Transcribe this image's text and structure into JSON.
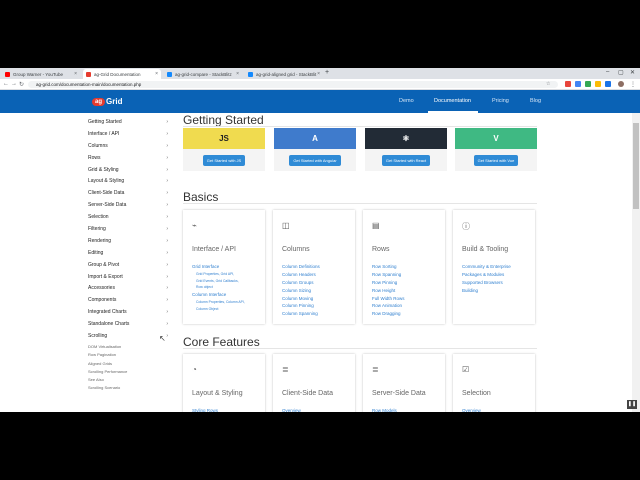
{
  "tabs": [
    {
      "title": "Group Warner - YouTube",
      "color": "#ff0000"
    },
    {
      "title": "ag-Grid Documentation",
      "color": "#e63b2e"
    },
    {
      "title": "ag-grid-compare - StackBlitz",
      "color": "#1389fd"
    },
    {
      "title": "ag-grid-aligned grid - StackBlit",
      "color": "#1389fd"
    }
  ],
  "address": "ag-grid.com/documentation-main/documentation.php",
  "site": {
    "logo_badge": "ag",
    "logo_word": "Grid",
    "nav": [
      "Demo",
      "Documentation",
      "Pricing",
      "Blog"
    ]
  },
  "sidebar": {
    "items": [
      "Getting Started",
      "Interface / API",
      "Columns",
      "Rows",
      "Grid & Styling",
      "Layout & Styling",
      "Client-Side Data",
      "Server-Side Data",
      "Selection",
      "Filtering",
      "Rendering",
      "Editing",
      "Group & Pivot",
      "Import & Export",
      "Accessories",
      "Components",
      "Integrated Charts",
      "Standalone Charts",
      "Scrolling"
    ],
    "sub": [
      "DOM Virtualisation",
      "Row Pagination",
      "Aligned Grids",
      "Scrolling Performance",
      "See Also",
      "Scrolling Scenario"
    ]
  },
  "sections": {
    "getting_started": "Getting Started",
    "basics": "Basics",
    "core": "Core Features"
  },
  "frameworks": [
    {
      "logo": "JS",
      "button": "Get Started with JS",
      "color": "#f0db4f"
    },
    {
      "logo": "A",
      "button": "Get Started with Angular",
      "color": "#3f7bcc"
    },
    {
      "logo": "⚛",
      "button": "Get Started with React",
      "color": "#222b36"
    },
    {
      "logo": "V",
      "button": "Get Started with Vue",
      "color": "#3fb983"
    }
  ],
  "basics_cards": [
    {
      "icon": "plug-icon",
      "glyph": "⌁",
      "title": "Interface / API",
      "links": [
        {
          "t": "Grid Interface",
          "s": false
        },
        {
          "t": "Grid Properties, Grid API,",
          "s": true
        },
        {
          "t": "Grid Events, Grid Callbacks,",
          "s": true
        },
        {
          "t": "Row object",
          "s": true
        },
        {
          "t": "Column Interface",
          "s": false
        },
        {
          "t": "Column Properties, Column API,",
          "s": true
        },
        {
          "t": "Column Object",
          "s": true
        }
      ]
    },
    {
      "icon": "columns-icon",
      "glyph": "◫",
      "title": "Columns",
      "links": [
        {
          "t": "Column Definitions",
          "s": false
        },
        {
          "t": "Column Headers",
          "s": false
        },
        {
          "t": "Column Groups",
          "s": false
        },
        {
          "t": "Column Sizing",
          "s": false
        },
        {
          "t": "Column Moving",
          "s": false
        },
        {
          "t": "Column Pinning",
          "s": false
        },
        {
          "t": "Column Spanning",
          "s": false
        }
      ]
    },
    {
      "icon": "rows-icon",
      "glyph": "▤",
      "title": "Rows",
      "links": [
        {
          "t": "Row Sorting",
          "s": false
        },
        {
          "t": "Row Spanning",
          "s": false
        },
        {
          "t": "Row Pinning",
          "s": false
        },
        {
          "t": "Row Height",
          "s": false
        },
        {
          "t": "Full Width Rows",
          "s": false
        },
        {
          "t": "Row Animation",
          "s": false
        },
        {
          "t": "Row Dragging",
          "s": false
        }
      ]
    },
    {
      "icon": "info-icon",
      "glyph": "ⓘ",
      "title": "Build & Tooling",
      "links": [
        {
          "t": "Community & Enterprise",
          "s": false
        },
        {
          "t": "Packages & Modules",
          "s": false
        },
        {
          "t": "Supported Browsers",
          "s": false
        },
        {
          "t": "Building",
          "s": false
        }
      ]
    }
  ],
  "core_cards": [
    {
      "icon": "palette-icon",
      "glyph": "◔",
      "title": "Layout & Styling",
      "links": [
        {
          "t": "Styling Rows",
          "s": false
        }
      ]
    },
    {
      "icon": "database-icon",
      "glyph": "≣",
      "title": "Client-Side Data",
      "links": [
        {
          "t": "Overview",
          "s": false
        }
      ]
    },
    {
      "icon": "database-icon",
      "glyph": "≣",
      "title": "Server-Side Data",
      "links": [
        {
          "t": "Row Models",
          "s": false
        }
      ]
    },
    {
      "icon": "checkbox-icon",
      "glyph": "☑",
      "title": "Selection",
      "links": [
        {
          "t": "Overview",
          "s": false
        }
      ]
    }
  ]
}
